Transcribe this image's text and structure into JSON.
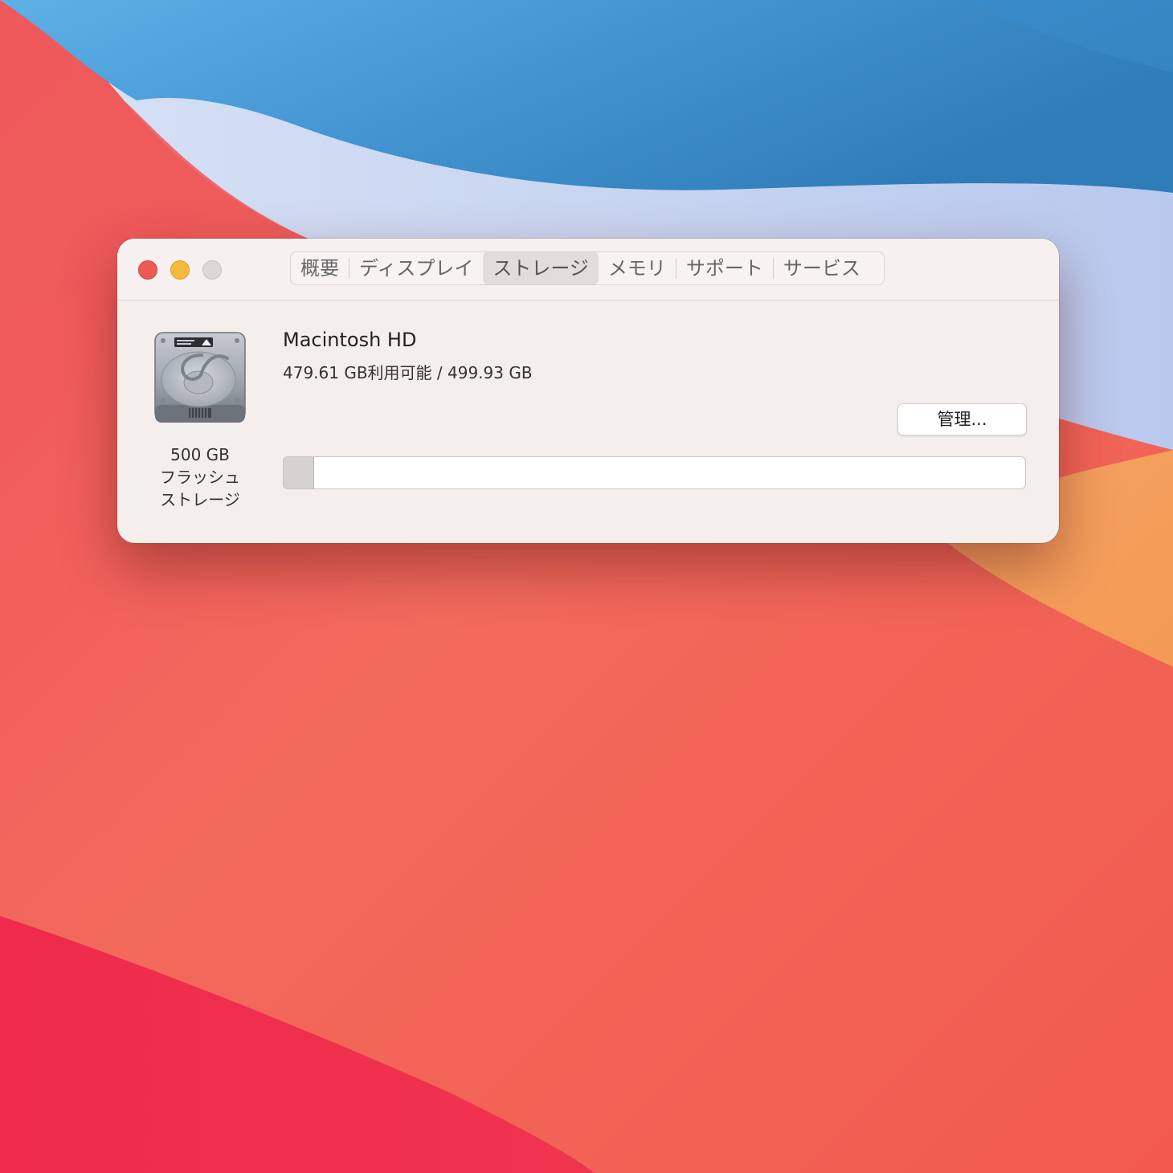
{
  "window": {
    "tabs": [
      {
        "label": "概要",
        "selected": false
      },
      {
        "label": "ディスプレイ",
        "selected": false
      },
      {
        "label": "ストレージ",
        "selected": true
      },
      {
        "label": "メモリ",
        "selected": false
      },
      {
        "label": "サポート",
        "selected": false
      },
      {
        "label": "サービス",
        "selected": false
      }
    ]
  },
  "storage": {
    "drive": {
      "icon": "hard-drive-icon",
      "capacity_label": "500 GB",
      "type_line1": "フラッシュ",
      "type_line2": "ストレージ"
    },
    "volume": {
      "name": "Macintosh HD",
      "usage_text": "479.61 GB利用可能 / 499.93 GB",
      "available_gb": 479.61,
      "total_gb": 499.93,
      "used_fraction": 0.04
    },
    "manage_label": "管理..."
  },
  "colors": {
    "close": "#ed5a56",
    "minimize": "#f5b93b",
    "zoom": "#dcd8d7"
  }
}
